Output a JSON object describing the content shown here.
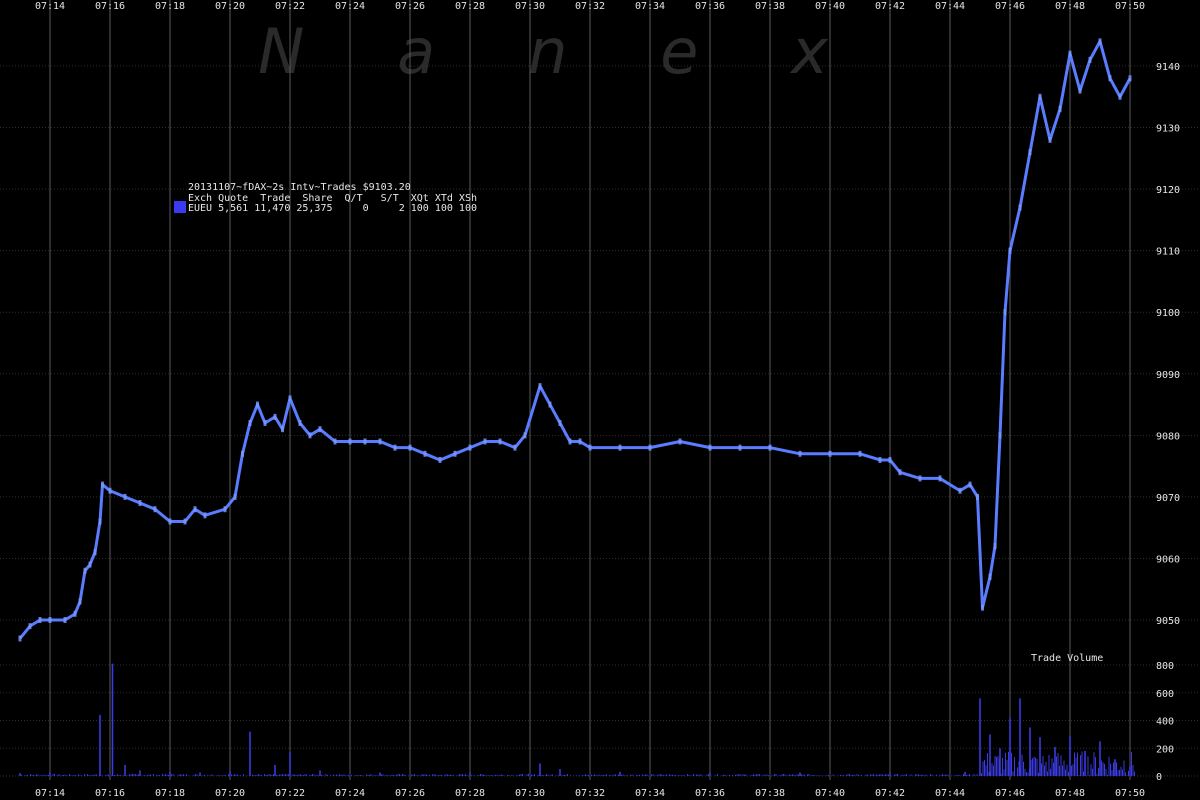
{
  "chart_data": {
    "type": "line",
    "watermark": "N a n e x",
    "legend": {
      "title": "20131107~fDAX~2s Intv~Trades $9103.20",
      "header": "Exch Quote  Trade  Share  Q/T   S/T  XQt XTd XSh",
      "row": "EUEU 5,561 11,470 25,375     0     2 100 100 100",
      "swatch_color": "#3a3af0"
    },
    "colors": {
      "background": "#000000",
      "grid": "#5a5a5a",
      "price_line": "#5a7cff",
      "volume_bars": "#3a3ae0",
      "text": "#e6e6e6"
    },
    "x_ticks": [
      "07:14",
      "07:16",
      "07:18",
      "07:20",
      "07:22",
      "07:24",
      "07:26",
      "07:28",
      "07:30",
      "07:32",
      "07:34",
      "07:36",
      "07:38",
      "07:40",
      "07:42",
      "07:44",
      "07:46",
      "07:48",
      "07:50"
    ],
    "x_range_minutes": [
      13.0,
      51.1
    ],
    "price_axis": {
      "ticks": [
        9050,
        9060,
        9070,
        9080,
        9090,
        9100,
        9110,
        9120,
        9130,
        9140
      ],
      "ylim": [
        9046,
        9149
      ]
    },
    "volume_axis": {
      "title": "Trade Volume",
      "ticks": [
        0,
        200,
        400,
        600,
        800
      ],
      "ylim": [
        0,
        830
      ]
    },
    "price_series": [
      {
        "x": "07:13:00",
        "y": 9047
      },
      {
        "x": "07:13:20",
        "y": 9049
      },
      {
        "x": "07:13:40",
        "y": 9050
      },
      {
        "x": "07:14:00",
        "y": 9050
      },
      {
        "x": "07:14:30",
        "y": 9050
      },
      {
        "x": "07:14:50",
        "y": 9051
      },
      {
        "x": "07:15:00",
        "y": 9053
      },
      {
        "x": "07:15:10",
        "y": 9058
      },
      {
        "x": "07:15:20",
        "y": 9059
      },
      {
        "x": "07:15:30",
        "y": 9061
      },
      {
        "x": "07:15:40",
        "y": 9066
      },
      {
        "x": "07:15:45",
        "y": 9072
      },
      {
        "x": "07:16:00",
        "y": 9071
      },
      {
        "x": "07:16:30",
        "y": 9070
      },
      {
        "x": "07:17:00",
        "y": 9069
      },
      {
        "x": "07:17:30",
        "y": 9068
      },
      {
        "x": "07:18:00",
        "y": 9066
      },
      {
        "x": "07:18:30",
        "y": 9066
      },
      {
        "x": "07:18:50",
        "y": 9068
      },
      {
        "x": "07:19:10",
        "y": 9067
      },
      {
        "x": "07:19:50",
        "y": 9068
      },
      {
        "x": "07:20:10",
        "y": 9070
      },
      {
        "x": "07:20:25",
        "y": 9077
      },
      {
        "x": "07:20:40",
        "y": 9082
      },
      {
        "x": "07:20:55",
        "y": 9085
      },
      {
        "x": "07:21:10",
        "y": 9082
      },
      {
        "x": "07:21:30",
        "y": 9083
      },
      {
        "x": "07:21:45",
        "y": 9081
      },
      {
        "x": "07:22:00",
        "y": 9086
      },
      {
        "x": "07:22:20",
        "y": 9082
      },
      {
        "x": "07:22:40",
        "y": 9080
      },
      {
        "x": "07:23:00",
        "y": 9081
      },
      {
        "x": "07:23:30",
        "y": 9079
      },
      {
        "x": "07:24:00",
        "y": 9079
      },
      {
        "x": "07:24:30",
        "y": 9079
      },
      {
        "x": "07:25:00",
        "y": 9079
      },
      {
        "x": "07:25:30",
        "y": 9078
      },
      {
        "x": "07:26:00",
        "y": 9078
      },
      {
        "x": "07:26:30",
        "y": 9077
      },
      {
        "x": "07:27:00",
        "y": 9076
      },
      {
        "x": "07:27:30",
        "y": 9077
      },
      {
        "x": "07:28:00",
        "y": 9078
      },
      {
        "x": "07:28:30",
        "y": 9079
      },
      {
        "x": "07:29:00",
        "y": 9079
      },
      {
        "x": "07:29:30",
        "y": 9078
      },
      {
        "x": "07:29:50",
        "y": 9080
      },
      {
        "x": "07:30:20",
        "y": 9088
      },
      {
        "x": "07:30:40",
        "y": 9085
      },
      {
        "x": "07:31:00",
        "y": 9082
      },
      {
        "x": "07:31:20",
        "y": 9079
      },
      {
        "x": "07:31:40",
        "y": 9079
      },
      {
        "x": "07:32:00",
        "y": 9078
      },
      {
        "x": "07:33:00",
        "y": 9078
      },
      {
        "x": "07:34:00",
        "y": 9078
      },
      {
        "x": "07:35:00",
        "y": 9079
      },
      {
        "x": "07:36:00",
        "y": 9078
      },
      {
        "x": "07:37:00",
        "y": 9078
      },
      {
        "x": "07:38:00",
        "y": 9078
      },
      {
        "x": "07:39:00",
        "y": 9077
      },
      {
        "x": "07:40:00",
        "y": 9077
      },
      {
        "x": "07:41:00",
        "y": 9077
      },
      {
        "x": "07:41:40",
        "y": 9076
      },
      {
        "x": "07:42:00",
        "y": 9076
      },
      {
        "x": "07:42:20",
        "y": 9074
      },
      {
        "x": "07:43:00",
        "y": 9073
      },
      {
        "x": "07:43:40",
        "y": 9073
      },
      {
        "x": "07:44:20",
        "y": 9071
      },
      {
        "x": "07:44:40",
        "y": 9072
      },
      {
        "x": "07:44:55",
        "y": 9070
      },
      {
        "x": "07:45:05",
        "y": 9052
      },
      {
        "x": "07:45:20",
        "y": 9057
      },
      {
        "x": "07:45:30",
        "y": 9062
      },
      {
        "x": "07:45:40",
        "y": 9080
      },
      {
        "x": "07:45:50",
        "y": 9100
      },
      {
        "x": "07:46:00",
        "y": 9110
      },
      {
        "x": "07:46:20",
        "y": 9117
      },
      {
        "x": "07:46:40",
        "y": 9126
      },
      {
        "x": "07:47:00",
        "y": 9135
      },
      {
        "x": "07:47:20",
        "y": 9128
      },
      {
        "x": "07:47:40",
        "y": 9133
      },
      {
        "x": "07:48:00",
        "y": 9142
      },
      {
        "x": "07:48:20",
        "y": 9136
      },
      {
        "x": "07:48:40",
        "y": 9141
      },
      {
        "x": "07:49:00",
        "y": 9144
      },
      {
        "x": "07:49:20",
        "y": 9138
      },
      {
        "x": "07:49:40",
        "y": 9135
      },
      {
        "x": "07:50:00",
        "y": 9138
      }
    ],
    "volume_series": [
      {
        "x": "07:13:00",
        "y": 20
      },
      {
        "x": "07:14:00",
        "y": 25
      },
      {
        "x": "07:15:40",
        "y": 440
      },
      {
        "x": "07:16:05",
        "y": 810
      },
      {
        "x": "07:16:30",
        "y": 80
      },
      {
        "x": "07:17:00",
        "y": 40
      },
      {
        "x": "07:18:00",
        "y": 30
      },
      {
        "x": "07:19:00",
        "y": 25
      },
      {
        "x": "07:20:00",
        "y": 35
      },
      {
        "x": "07:20:40",
        "y": 320
      },
      {
        "x": "07:21:30",
        "y": 80
      },
      {
        "x": "07:22:00",
        "y": 170
      },
      {
        "x": "07:23:00",
        "y": 40
      },
      {
        "x": "07:25:00",
        "y": 25
      },
      {
        "x": "07:28:00",
        "y": 25
      },
      {
        "x": "07:30:20",
        "y": 90
      },
      {
        "x": "07:31:00",
        "y": 50
      },
      {
        "x": "07:33:00",
        "y": 30
      },
      {
        "x": "07:36:00",
        "y": 25
      },
      {
        "x": "07:39:00",
        "y": 25
      },
      {
        "x": "07:42:00",
        "y": 25
      },
      {
        "x": "07:44:30",
        "y": 30
      },
      {
        "x": "07:45:00",
        "y": 560
      },
      {
        "x": "07:45:20",
        "y": 300
      },
      {
        "x": "07:45:40",
        "y": 200
      },
      {
        "x": "07:46:00",
        "y": 420
      },
      {
        "x": "07:46:20",
        "y": 560
      },
      {
        "x": "07:46:40",
        "y": 350
      },
      {
        "x": "07:47:00",
        "y": 280
      },
      {
        "x": "07:47:30",
        "y": 210
      },
      {
        "x": "07:48:00",
        "y": 290
      },
      {
        "x": "07:48:30",
        "y": 180
      },
      {
        "x": "07:49:00",
        "y": 250
      },
      {
        "x": "07:49:30",
        "y": 120
      },
      {
        "x": "07:50:00",
        "y": 70
      }
    ]
  }
}
